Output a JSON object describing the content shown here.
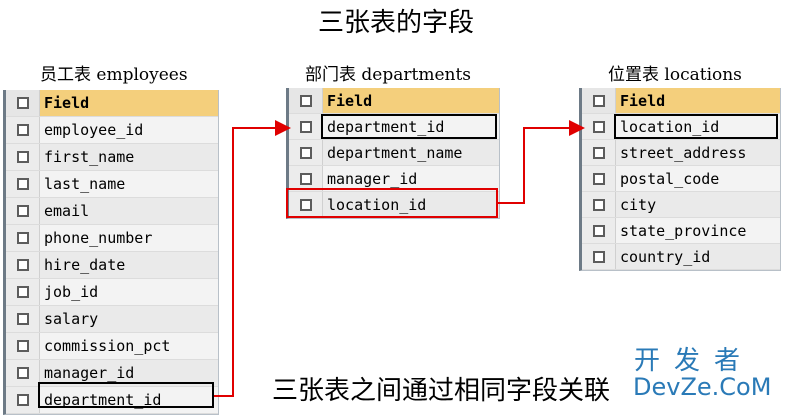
{
  "title": "三张表的字段",
  "footer_text": "三张表之间通过相同字段关联",
  "watermark": {
    "cn": "开发者",
    "en": "DevZe.CoM"
  },
  "colors": {
    "header_field": "#f4cf7c",
    "link_red": "#e00000",
    "watermark": "#2a7ab7"
  },
  "tables": [
    {
      "caption": "员工表 employees",
      "header": "Field",
      "fields": [
        "employee_id",
        "first_name",
        "last_name",
        "email",
        "phone_number",
        "hire_date",
        "job_id",
        "salary",
        "commission_pct",
        "manager_id",
        "department_id"
      ]
    },
    {
      "caption": "部门表 departments",
      "header": "Field",
      "fields": [
        "department_id",
        "department_name",
        "manager_id",
        "location_id"
      ]
    },
    {
      "caption": "位置表 locations",
      "header": "Field",
      "fields": [
        "location_id",
        "street_address",
        "postal_code",
        "city",
        "state_province",
        "country_id"
      ]
    }
  ]
}
